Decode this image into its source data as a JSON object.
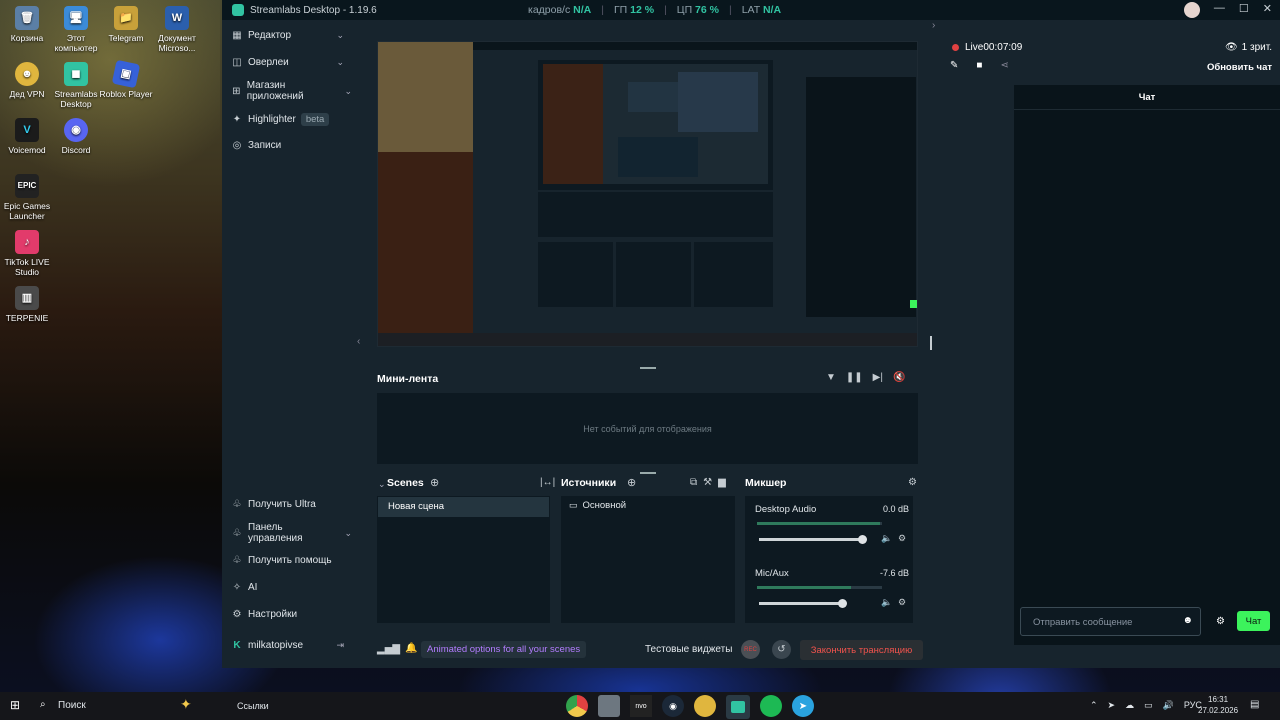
{
  "desktop": {
    "icons": [
      {
        "label": "Корзина",
        "icon": "recycle-bin-icon",
        "color": "#5b7fa6"
      },
      {
        "label": "Этот компьютер",
        "icon": "computer-icon",
        "color": "#3b8bd8"
      },
      {
        "label": "Telegram",
        "icon": "telegram-folder-icon",
        "color": "#c8a13a"
      },
      {
        "label": "Документ Microso...",
        "icon": "word-doc-icon",
        "color": "#2b5fad"
      },
      {
        "label": "Дед VPN",
        "icon": "vpn-icon",
        "color": "#e0b63e"
      },
      {
        "label": "Streamlabs Desktop",
        "icon": "streamlabs-icon",
        "color": "#31c3a2"
      },
      {
        "label": "Roblox Player",
        "icon": "roblox-icon",
        "color": "#3661d9"
      },
      {
        "label": "Voicemod",
        "icon": "voicemod-icon",
        "color": "#1b1b1b"
      },
      {
        "label": "Discord",
        "icon": "discord-icon",
        "color": "#5865f2"
      },
      {
        "label": "Epic Games Launcher",
        "icon": "epic-icon",
        "color": "#222"
      },
      {
        "label": "TikTok LIVE Studio",
        "icon": "tiktok-icon",
        "color": "#e23b6b"
      },
      {
        "label": "TERPENIE",
        "icon": "game-icon",
        "color": "#4a4a4a"
      }
    ]
  },
  "window": {
    "title": "Streamlabs Desktop - 1.19.6",
    "stats": {
      "fps_label": "кадров/с",
      "fps_value": "N/A",
      "gpu_label": "ГП",
      "gpu_value": "12 %",
      "cpu_label": "ЦП",
      "cpu_value": "76 %",
      "lat_label": "LAT",
      "lat_value": "N/A"
    }
  },
  "nav": {
    "items": [
      {
        "label": "Редактор",
        "icon": "layout-icon"
      },
      {
        "label": "Оверлеи",
        "icon": "overlay-icon"
      },
      {
        "label": "Магазин приложений",
        "icon": "store-icon"
      },
      {
        "label": "Highlighter",
        "icon": "highlighter-icon",
        "badge": "beta"
      },
      {
        "label": "Записи",
        "icon": "recordings-icon"
      }
    ],
    "bottom": [
      {
        "label": "Получить Ultra",
        "icon": "ultra-icon"
      },
      {
        "label": "Панель управления",
        "icon": "dashboard-icon"
      },
      {
        "label": "Получить помощь",
        "icon": "help-icon"
      },
      {
        "label": "AI",
        "icon": "ai-icon"
      },
      {
        "label": "Настройки",
        "icon": "settings-icon"
      }
    ],
    "user": "milkatopivse"
  },
  "minifeed": {
    "title": "Мини-лента",
    "empty_text": "Нет событий для отображения"
  },
  "scenes": {
    "title": "Scenes",
    "items": [
      "Новая сцена"
    ]
  },
  "sources": {
    "title": "Источники",
    "items": [
      "Основной"
    ]
  },
  "mixer": {
    "title": "Микшер",
    "channels": [
      {
        "name": "Desktop Audio",
        "db": "0.0 dB",
        "level": 0.98
      },
      {
        "name": "Mic/Aux",
        "db": "-7.6 dB",
        "level": 0.75
      }
    ]
  },
  "footer": {
    "promo": "Animated options for all your scenes",
    "test_widgets": "Тестовые виджеты",
    "rec_label": "REC",
    "end_stream": "Закончить трансляцию"
  },
  "live": {
    "status": "Live",
    "time": "00:07:09",
    "viewers": "1 зрит.",
    "refresh_chat": "Обновить чат",
    "chat_title": "Чат",
    "chat_placeholder": "Отправить сообщение",
    "chat_button": "Чат"
  },
  "taskbar": {
    "search": "Поиск",
    "links": "Ссылки",
    "lang": "РУС",
    "time": "16:31",
    "date": "27.02.2026",
    "apps": [
      "chrome-icon",
      "explorer-icon",
      "nvidia-icon",
      "steam-icon",
      "vpn-icon",
      "streamlabs-icon",
      "spotify-icon",
      "telegram-icon"
    ]
  },
  "colors": {
    "accent": "#31c3a2",
    "live_red": "#e04141",
    "chat_button_green": "#3cf35c",
    "promo_purple": "#b37dff",
    "end_stream_red": "#f0534d"
  }
}
